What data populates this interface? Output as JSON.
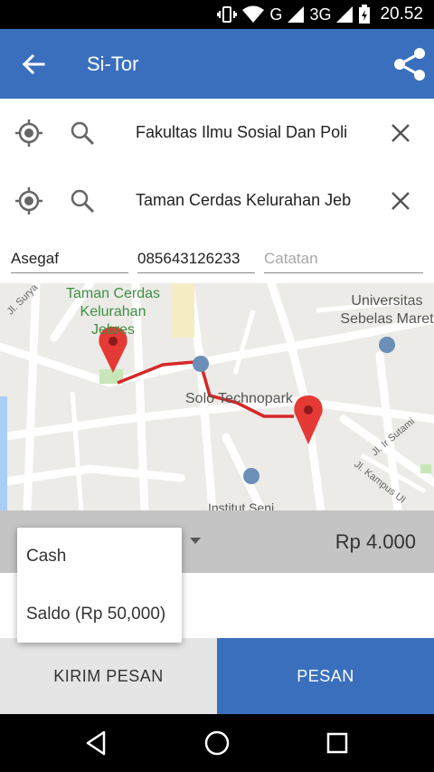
{
  "status_bar": {
    "signal_label": "G",
    "network_label": "3G",
    "time": "20.52"
  },
  "app_bar": {
    "title": "Si-Tor"
  },
  "locations": [
    {
      "text": "Fakultas Ilmu Sosial Dan Poli"
    },
    {
      "text": "Taman Cerdas Kelurahan Jeb"
    }
  ],
  "form": {
    "name_value": "Asegaf",
    "phone_value": "085643126233",
    "note_placeholder": "Catatan"
  },
  "map": {
    "labels": {
      "taman": "Taman Cerdas\nKelurahan\nJebres",
      "universitas": "Universitas\nSebelas Maret",
      "solo": "Solo Technopark",
      "sutami": "Jl. Ir Sutami",
      "kampus": "Jl. Kampus UI",
      "surya": "Jl. Surya",
      "institut": "Institut Seni"
    },
    "route_color": "#d62828",
    "marker_color": "#e53935"
  },
  "payment": {
    "price": "Rp 4.000",
    "options": [
      "Cash",
      "Saldo (Rp 50,000)"
    ]
  },
  "actions": {
    "send_label": "KIRIM PESAN",
    "order_label": "PESAN"
  },
  "colors": {
    "primary": "#3a6fbe"
  }
}
